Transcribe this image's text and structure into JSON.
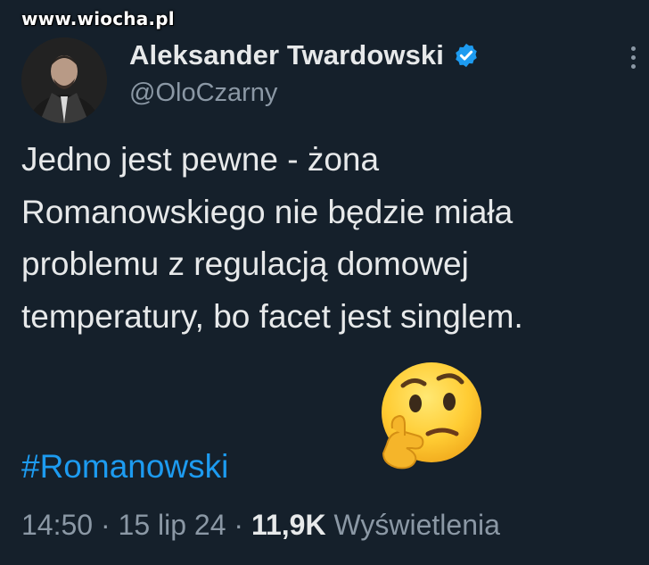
{
  "watermark": "www.wiocha.pl",
  "author": {
    "display_name": "Aleksander Twardowski",
    "handle": "@OloCzarny",
    "verified_icon": "verified-badge-icon",
    "avatar": "avatar"
  },
  "tweet": {
    "text": "Jedno jest pewne - żona Romanowskiego nie będzie miała problemu z regulacją domowej temperatury, bo facet jest singlem.",
    "emoji": "thinking-face-icon",
    "hashtag": "#Romanowski"
  },
  "meta": {
    "time": "14:50",
    "separator": "·",
    "date": "15 lip 24",
    "views_count": "11,9K",
    "views_label": "Wyświetlenia"
  },
  "colors": {
    "background": "#15202b",
    "text": "#e7e9ea",
    "muted": "#8b98a5",
    "accent": "#1d9bf0"
  }
}
